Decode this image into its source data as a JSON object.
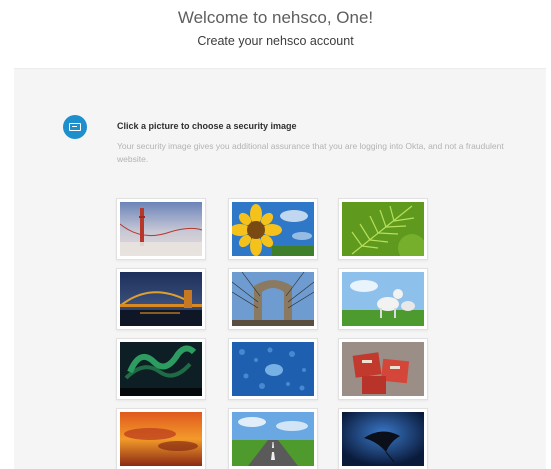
{
  "header": {
    "welcome": "Welcome to nehsco, One!",
    "subtitle": "Create your nehsco account"
  },
  "security_step": {
    "icon": "security-image-icon",
    "heading": "Click a picture to choose a security image",
    "description": "Your security image gives you additional assurance that you are logging into Okta, and not a fraudulent website."
  },
  "images": [
    {
      "name": "golden-gate-bridge-fog"
    },
    {
      "name": "sunflower"
    },
    {
      "name": "green-fern"
    },
    {
      "name": "bridge-at-night"
    },
    {
      "name": "brooklyn-bridge"
    },
    {
      "name": "goats-on-grass"
    },
    {
      "name": "aurora-borealis"
    },
    {
      "name": "water-droplets-blue"
    },
    {
      "name": "red-letter-blocks"
    },
    {
      "name": "fiery-sunset-clouds"
    },
    {
      "name": "open-road"
    },
    {
      "name": "stingray-underwater"
    }
  ],
  "colors": {
    "accent": "#1d8fcd",
    "card_background": "#f5f5f5"
  }
}
